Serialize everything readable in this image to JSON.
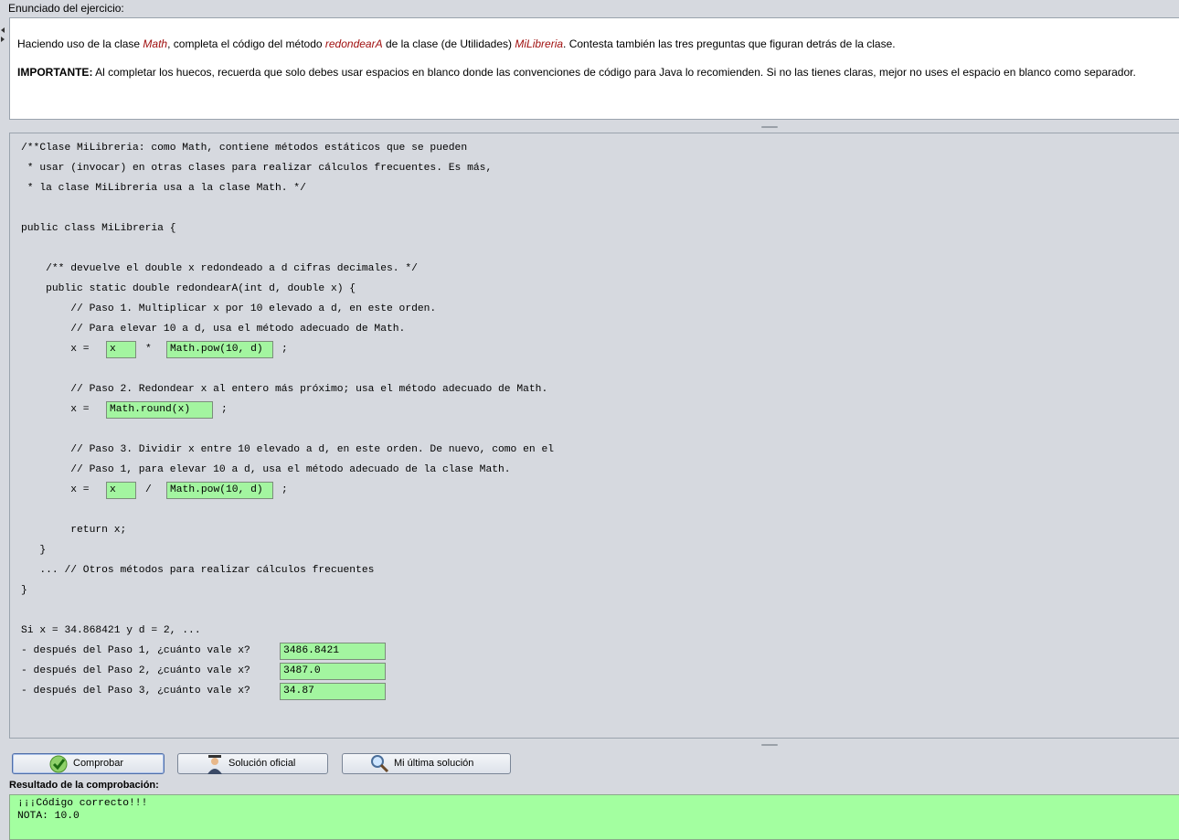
{
  "enunciado": {
    "title": "Enunciado del ejercicio:",
    "p1_a": "Haciendo uso de la clase ",
    "p1_math": "Math",
    "p1_b": ", completa el código del método ",
    "p1_method": "redondearA",
    "p1_c": " de la clase (de Utilidades) ",
    "p1_class": "MiLibreria",
    "p1_d": ". Contesta también las tres preguntas que figuran detrás de la clase.",
    "p2_bold": "IMPORTANTE:",
    "p2_rest": " Al completar los huecos, recuerda que solo debes usar espacios en blanco donde las convenciones de código para Java lo recomienden. Si no las tienes claras, mejor no uses el espacio en blanco como separador."
  },
  "code": {
    "l1": "/**Clase MiLibreria: como Math, contiene métodos estáticos que se pueden",
    "l2": " * usar (invocar) en otras clases para realizar cálculos frecuentes. Es más,",
    "l3": " * la clase MiLibreria usa a la clase Math. */",
    "l5": "public class MiLibreria {",
    "l8": "    /** devuelve el double x redondeado a d cifras decimales. */",
    "l9": "    public static double redondearA(int d, double x) {",
    "l10": "        // Paso 1. Multiplicar x por 10 elevado a d, en este orden.",
    "l11": "        // Para elevar 10 a d, usa el método adecuado de Math.",
    "l12_a": "        x =",
    "l12_op": "*",
    "l12_end": ";",
    "l14": "        // Paso 2. Redondear x al entero más próximo; usa el método adecuado de Math.",
    "l15_a": "        x =",
    "l15_end": ";",
    "l17": "        // Paso 3. Dividir x entre 10 elevado a d, en este orden. De nuevo, como en el",
    "l18": "        // Paso 1, para elevar 10 a d, usa el método adecuado de la clase Math.",
    "l19_a": "        x =",
    "l19_op": "/",
    "l19_end": ";",
    "l21": "        return x;",
    "l22": "   }",
    "l23": "   ... // Otros métodos para realizar cálculos frecuentes",
    "l24": "}",
    "l26": "Si x = 34.868421 y d = 2, ...",
    "q1": "- después del Paso 1, ¿cuánto vale x?",
    "q2": "- después del Paso 2, ¿cuánto vale x?",
    "q3": "- después del Paso 3, ¿cuánto vale x?"
  },
  "fields": {
    "p1_left": "x",
    "p1_right": "Math.pow(10, d)",
    "p2": "Math.round(x)",
    "p3_left": "x",
    "p3_right": "Math.pow(10, d)",
    "a1": "3486.8421",
    "a2": "3487.0",
    "a3": "34.87"
  },
  "buttons": {
    "comprobar": "Comprobar",
    "solucion": "Solución oficial",
    "ultima": "Mi última solución"
  },
  "resultado": {
    "title": "Resultado de la comprobación:",
    "line1": "¡¡¡Código correcto!!!",
    "line2": "NOTA: 10.0"
  },
  "colors": {
    "field_fill": "#a3f5a0",
    "result_fill": "#a3ffa0",
    "emphasis": "#a01010"
  },
  "icons": [
    "check-icon",
    "professor-icon",
    "magnifier-icon"
  ]
}
